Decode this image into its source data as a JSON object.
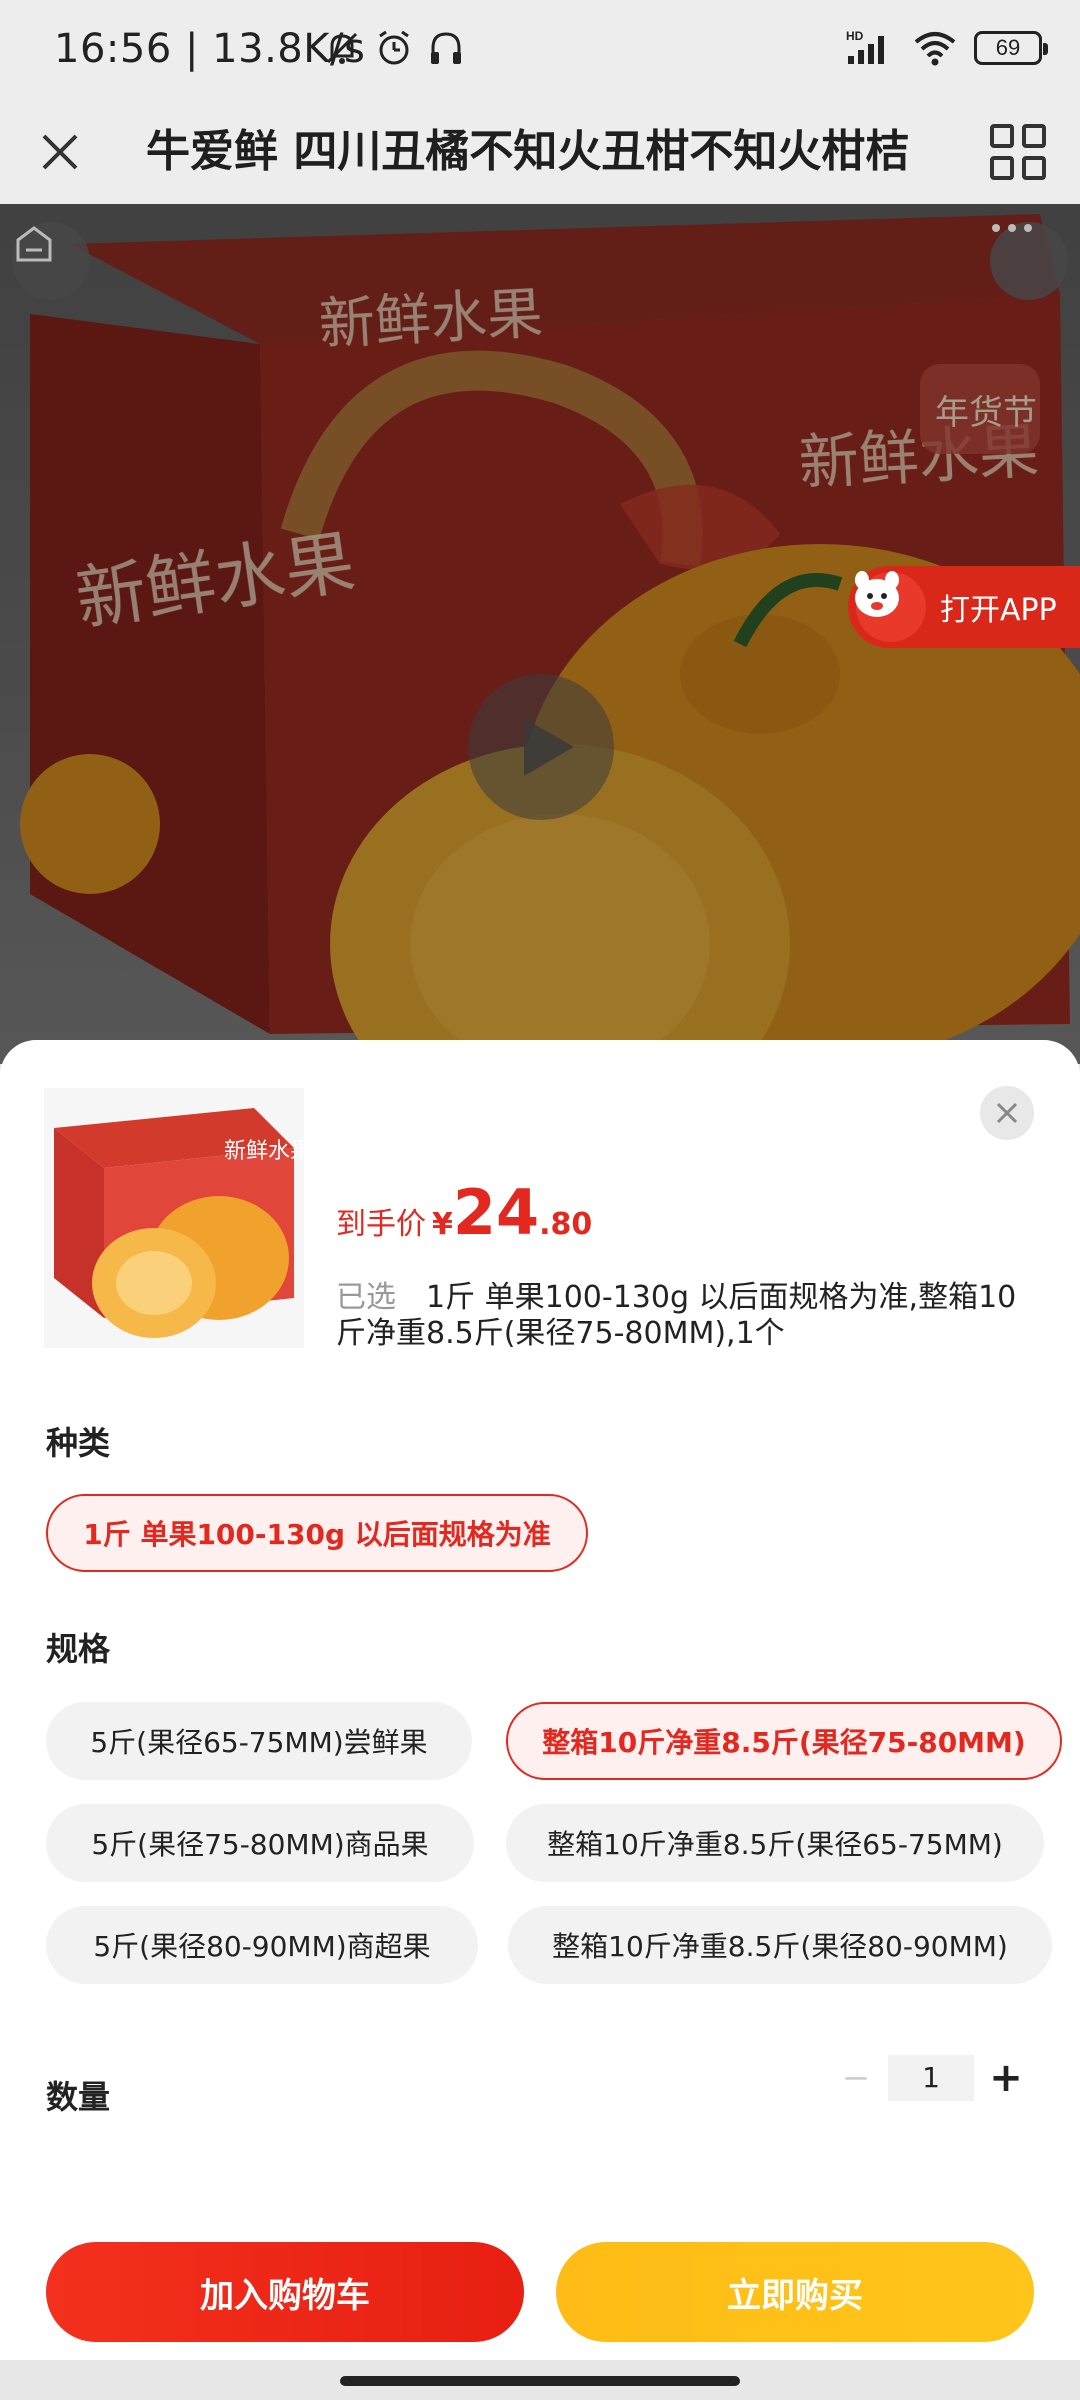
{
  "status_bar": {
    "time_speed": "16:56 | 13.8K/s",
    "battery": "69",
    "network_label": "HD"
  },
  "title_bar": {
    "title": "牛爱鲜 四川丑橘不知火丑柑不知火柑桔"
  },
  "hero": {
    "open_app_label": "打开APP",
    "box_text": "新鲜水果",
    "badge_text": "年货节"
  },
  "sheet": {
    "price_label": "到手价",
    "price_symbol": "¥",
    "price_integer": "24",
    "price_decimal": ".80",
    "selected_label": "已选",
    "selected_value": "1斤 单果100-130g 以后面规格为准,整箱10斤净重8.5斤(果径75-80MM),1个",
    "type_section_title": "种类",
    "type_options": [
      {
        "label": "1斤 单果100-130g 以后面规格为准",
        "selected": true
      }
    ],
    "spec_section_title": "规格",
    "spec_options": [
      {
        "label": "5斤(果径65-75MM)尝鲜果",
        "selected": false
      },
      {
        "label": "整箱10斤净重8.5斤(果径75-80MM)",
        "selected": true
      },
      {
        "label": "5斤(果径75-80MM)商品果",
        "selected": false
      },
      {
        "label": "整箱10斤净重8.5斤(果径65-75MM)",
        "selected": false
      },
      {
        "label": "5斤(果径80-90MM)商超果",
        "selected": false
      },
      {
        "label": "整箱10斤净重8.5斤(果径80-90MM)",
        "selected": false
      }
    ],
    "quantity_title": "数量",
    "quantity_value": "1",
    "minus_label": "−",
    "plus_label": "+",
    "add_to_cart": "加入购物车",
    "buy_now": "立即购买"
  },
  "colors": {
    "accent_red": "#e3281f",
    "buy_yellow": "#ffc01a",
    "selected_bg": "#fdf0ee"
  }
}
